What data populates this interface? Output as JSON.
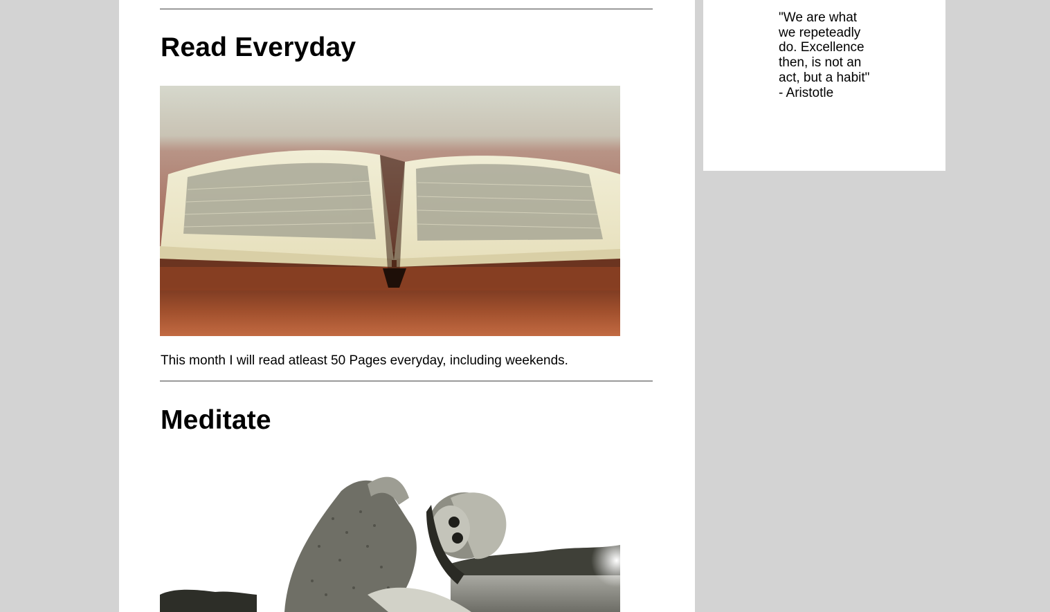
{
  "sections": [
    {
      "title": "Read Everyday",
      "image": "open-book-photo",
      "description": "This month I will read atleast 50 Pages everyday, including weekends."
    },
    {
      "title": "Meditate",
      "image": "woman-meditating-photo"
    }
  ],
  "sidebar": {
    "quote": "\"We are what we repeteadly do. Excellence then, is not an act, but a habit\" - Aristotle"
  },
  "colors": {
    "page_background": "#d3d3d3",
    "panel_background": "#ffffff",
    "divider": "#9a9a9a"
  }
}
